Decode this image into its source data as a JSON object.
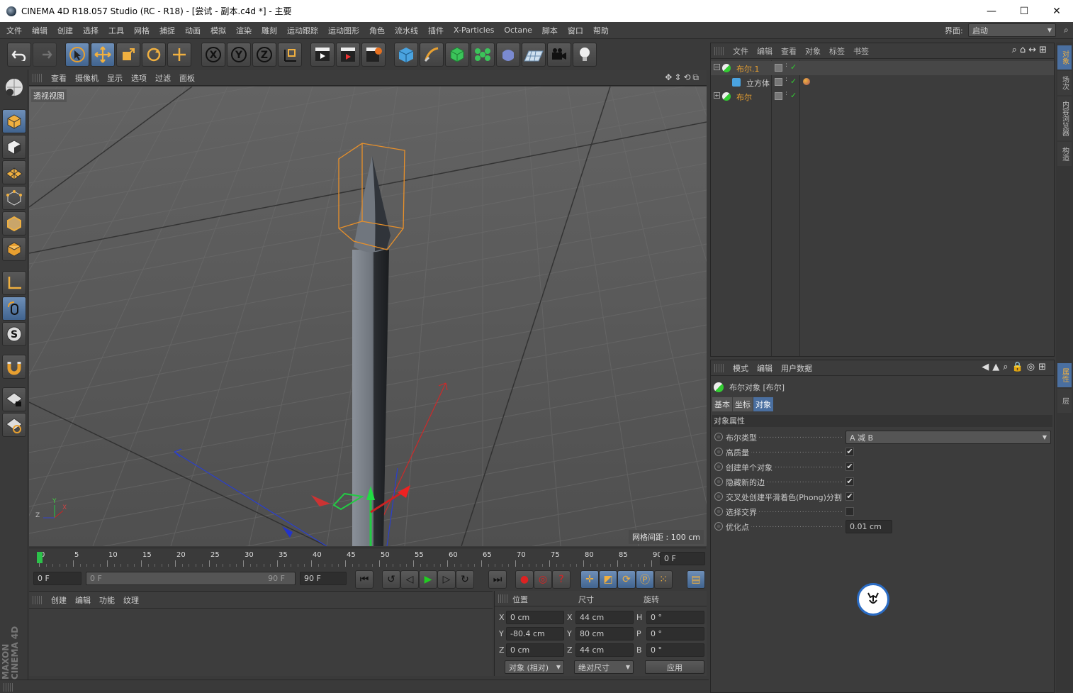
{
  "titlebar": {
    "title": "CINEMA 4D R18.057 Studio (RC - R18) - [尝试 - 副本.c4d *] - 主要",
    "min": "—",
    "max": "☐",
    "close": "✕"
  },
  "menu": [
    "文件",
    "编辑",
    "创建",
    "选择",
    "工具",
    "网格",
    "捕捉",
    "动画",
    "模拟",
    "渲染",
    "雕刻",
    "运动跟踪",
    "运动图形",
    "角色",
    "流水线",
    "插件",
    "X-Particles",
    "Octane",
    "脚本",
    "窗口",
    "帮助"
  ],
  "layout": {
    "label": "界面:",
    "value": "启动"
  },
  "viewport": {
    "menu": [
      "查看",
      "摄像机",
      "显示",
      "选项",
      "过滤",
      "面板"
    ],
    "label": "透视视图",
    "grid_spacing": "网格间距 : 100 cm",
    "axis_x": "X",
    "axis_y": "Y",
    "axis_z": "Z"
  },
  "timeline": {
    "ticks": [
      "0",
      "5",
      "10",
      "15",
      "20",
      "25",
      "30",
      "35",
      "40",
      "45",
      "50",
      "55",
      "60",
      "65",
      "70",
      "75",
      "80",
      "85",
      "90"
    ],
    "current": "0 F"
  },
  "transport": {
    "start": "0 F",
    "range_start": "0 F",
    "range_end": "90 F",
    "end": "90 F"
  },
  "materials": {
    "menu": [
      "创建",
      "编辑",
      "功能",
      "纹理"
    ]
  },
  "coords": {
    "headers": [
      "位置",
      "尺寸",
      "旋转"
    ],
    "rows": [
      {
        "axis": "X",
        "pos": "0 cm",
        "saxis": "X",
        "size": "44 cm",
        "raxis": "H",
        "rot": "0 °"
      },
      {
        "axis": "Y",
        "pos": "-80.4 cm",
        "saxis": "Y",
        "size": "80 cm",
        "raxis": "P",
        "rot": "0 °"
      },
      {
        "axis": "Z",
        "pos": "0 cm",
        "saxis": "Z",
        "size": "44 cm",
        "raxis": "B",
        "rot": "0 °"
      }
    ],
    "mode": "对象 (相对)",
    "size_mode": "绝对尺寸",
    "apply": "应用"
  },
  "objects": {
    "menu": [
      "文件",
      "编辑",
      "查看",
      "对象",
      "标签",
      "书签"
    ],
    "items": [
      {
        "name": "布尔.1",
        "color": "#e8a030"
      },
      {
        "name": "立方体",
        "color": "#d0d0d0"
      },
      {
        "name": "布尔",
        "color": "#e8a030"
      }
    ]
  },
  "attributes": {
    "menu": [
      "模式",
      "编辑",
      "用户数据"
    ],
    "title": "布尔对象 [布尔]",
    "tabs": [
      "基本",
      "坐标",
      "对象"
    ],
    "section": "对象属性",
    "rows": [
      {
        "label": "布尔类型",
        "value": "A 减 B"
      },
      {
        "label": "高质量",
        "value": "✔"
      },
      {
        "label": "创建单个对象",
        "value": "✔"
      },
      {
        "label": "隐藏新的边",
        "value": "✔"
      },
      {
        "label": "交叉处创建平滑着色(Phong)分割",
        "value": "✔"
      },
      {
        "label": "选择交界",
        "value": ""
      },
      {
        "label": "优化点",
        "value": "0.01 cm"
      }
    ]
  },
  "side_tabs": [
    "对象",
    "场次",
    "内容浏览器",
    "构造"
  ],
  "side_tabs2": [
    "属性",
    "层"
  ],
  "brand": "MAXON CINEMA 4D",
  "colors": {
    "accent": "#e8a030",
    "active_blue": "#4a6fa0"
  }
}
